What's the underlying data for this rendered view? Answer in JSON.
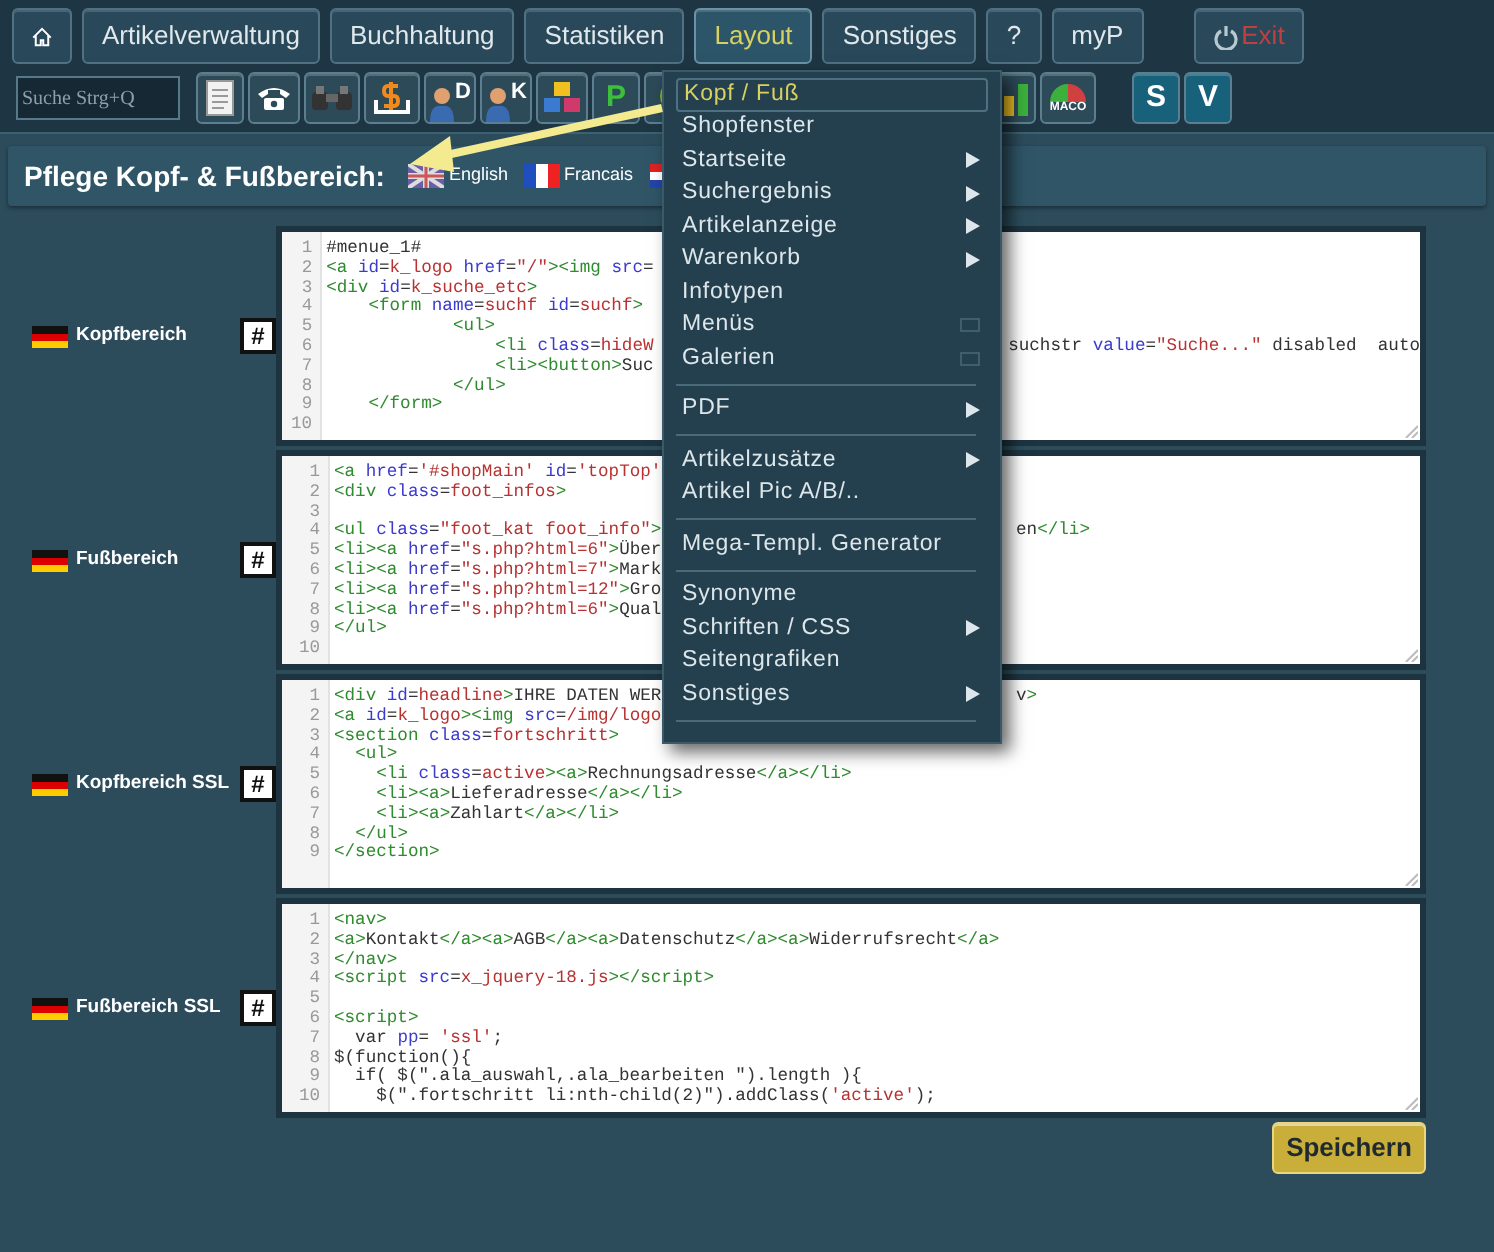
{
  "menubar": [
    {
      "kind": "home",
      "selected": false
    },
    {
      "kind": "text",
      "label": "Artikelverwaltung",
      "selected": false
    },
    {
      "kind": "text",
      "label": "Buchhaltung",
      "selected": false
    },
    {
      "kind": "text",
      "label": "Statistiken",
      "selected": false
    },
    {
      "kind": "text",
      "label": "Layout",
      "selected": true
    },
    {
      "kind": "text",
      "label": "Sonstiges",
      "selected": false
    },
    {
      "kind": "text",
      "label": "?",
      "selected": false
    },
    {
      "kind": "text",
      "label": "myP",
      "selected": false
    },
    {
      "kind": "exit",
      "label": "Exit",
      "selected": false
    }
  ],
  "search": {
    "placeholder": "Suche Strg+Q"
  },
  "toolbar": [
    {
      "kind": "document"
    },
    {
      "kind": "phone"
    },
    {
      "kind": "binoculars"
    },
    {
      "kind": "dollar"
    },
    {
      "kind": "person",
      "label": "D"
    },
    {
      "kind": "person",
      "label": "K"
    },
    {
      "kind": "cubes"
    },
    {
      "kind": "letter",
      "label": "P"
    },
    {
      "kind": "leaf"
    },
    {
      "kind": "gap"
    },
    {
      "kind": "bars"
    },
    {
      "kind": "gauge",
      "label": "MACO"
    },
    {
      "kind": "gap_small"
    },
    {
      "kind": "letter_dark",
      "label": "S"
    },
    {
      "kind": "letter_dark",
      "label": "V"
    }
  ],
  "header": {
    "title": "Pflege Kopf- & Fußbereich:",
    "languages": [
      {
        "kind": "uk",
        "label": "English"
      },
      {
        "kind": "fr",
        "label": "Francais"
      },
      {
        "kind": "nl"
      }
    ]
  },
  "sections": [
    {
      "label": "Kopfbereich",
      "button": "#",
      "lines": [
        {
          "number": "1",
          "text": "#menue_1#"
        },
        {
          "number": "2",
          "text": "<a id=k_logo href=\"/\"><img src="
        },
        {
          "number": "3",
          "text": "<div id=k_suche_etc>"
        },
        {
          "number": "4",
          "text": "    <form name=suchf id=suchf>"
        },
        {
          "number": "5",
          "text": "            <ul>"
        },
        {
          "number": "6",
          "text": "                <li class=hideW",
          "right": "suchstr value=\"Suche...\" disabled  auto"
        },
        {
          "number": "7",
          "text": "                <li><button>Suc"
        },
        {
          "number": "8",
          "text": "            </ul>"
        },
        {
          "number": "9",
          "text": "    </form>"
        },
        {
          "number": "10"
        }
      ]
    },
    {
      "label": "Fußbereich",
      "button": "#",
      "lines": [
        {
          "number": "1",
          "text": "<a href='#shopMain' id='topTop'"
        },
        {
          "number": "2",
          "text": "<div class=foot_infos>"
        },
        {
          "number": "3"
        },
        {
          "number": "4",
          "text": "<ul class=\"foot_kat foot_info\">",
          "right": "en</li>"
        },
        {
          "number": "5",
          "text": "<li><a href=\"s.php?html=6\">Über"
        },
        {
          "number": "6",
          "text": "<li><a href=\"s.php?html=7\">Mark"
        },
        {
          "number": "7",
          "text": "<li><a href=\"s.php?html=12\">Gro"
        },
        {
          "number": "8",
          "text": "<li><a href=\"s.php?html=6\">Qual"
        },
        {
          "number": "9",
          "text": "</ul>"
        },
        {
          "number": "10"
        }
      ]
    },
    {
      "label": "Kopfbereich SSL",
      "button": "#",
      "lines": [
        {
          "number": "1",
          "text": "<div id=headline>IHRE DATEN WER",
          "right": "v>"
        },
        {
          "number": "2",
          "text": "<a id=k_logo><img src=/img/logo"
        },
        {
          "number": "3",
          "text": "<section class=fortschritt>"
        },
        {
          "number": "4",
          "text": "  <ul>"
        },
        {
          "number": "5",
          "text": "    <li class=active><a>Rechnungsadresse</a></li>"
        },
        {
          "number": "6",
          "text": "    <li><a>Lieferadresse</a></li>"
        },
        {
          "number": "7",
          "text": "    <li><a>Zahlart</a></li>"
        },
        {
          "number": "8",
          "text": "  </ul>"
        },
        {
          "number": "9",
          "text": "</section>"
        }
      ]
    },
    {
      "label": "Fußbereich SSL",
      "button": "#",
      "lines": [
        {
          "number": "1",
          "text": "<nav>"
        },
        {
          "number": "2",
          "text": "<a>Kontakt</a><a>AGB</a><a>Datenschutz</a><a>Widerrufsrecht</a>"
        },
        {
          "number": "3",
          "text": "</nav>"
        },
        {
          "number": "4",
          "text": "<script src=x_jquery-18.js></script>"
        },
        {
          "number": "5"
        },
        {
          "number": "6",
          "text": "<script>"
        },
        {
          "number": "7",
          "text": "  var pp= 'ssl';"
        },
        {
          "number": "8",
          "text": "$(function(){"
        },
        {
          "number": "9",
          "text": "  if( $(\".ala_auswahl,.ala_bearbeiten \").length ){"
        },
        {
          "number": "10",
          "text": "    $(\".fortschritt li:nth-child(2)\").addClass('active');"
        }
      ]
    }
  ],
  "save_button": "Speichern",
  "dropdown": [
    {
      "kind": "item",
      "label": "Kopf / Fuß",
      "selected": true,
      "submenu": false
    },
    {
      "kind": "item",
      "label": "Shopfenster",
      "selected": false,
      "submenu": false
    },
    {
      "kind": "item",
      "label": "Startseite",
      "selected": false,
      "submenu": true
    },
    {
      "kind": "item",
      "label": "Suchergebnis",
      "selected": false,
      "submenu": true
    },
    {
      "kind": "item",
      "label": "Artikelanzeige",
      "selected": false,
      "submenu": true
    },
    {
      "kind": "item",
      "label": "Warenkorb",
      "selected": false,
      "submenu": true
    },
    {
      "kind": "item",
      "label": "Infotypen",
      "selected": false,
      "submenu": false
    },
    {
      "kind": "item",
      "label": "Menüs",
      "selected": false,
      "submenu": false,
      "window_icon": true
    },
    {
      "kind": "item",
      "label": "Galerien",
      "selected": false,
      "submenu": false,
      "window_icon": true
    },
    {
      "kind": "separator"
    },
    {
      "kind": "item",
      "label": "PDF",
      "selected": false,
      "submenu": true
    },
    {
      "kind": "separator"
    },
    {
      "kind": "item",
      "label": "Artikelzusätze",
      "selected": false,
      "submenu": true
    },
    {
      "kind": "item",
      "label": "Artikel Pic A/B/..",
      "selected": false,
      "submenu": false
    },
    {
      "kind": "separator"
    },
    {
      "kind": "item",
      "label": "Mega-Templ. Generator",
      "selected": false,
      "submenu": false
    },
    {
      "kind": "separator"
    },
    {
      "kind": "item",
      "label": "Synonyme",
      "selected": false,
      "submenu": false
    },
    {
      "kind": "item",
      "label": "Schriften / CSS",
      "selected": false,
      "submenu": true
    },
    {
      "kind": "item",
      "label": "Seitengrafiken",
      "selected": false,
      "submenu": false
    },
    {
      "kind": "item",
      "label": "Sonstiges",
      "selected": false,
      "submenu": true
    },
    {
      "kind": "separator"
    }
  ]
}
